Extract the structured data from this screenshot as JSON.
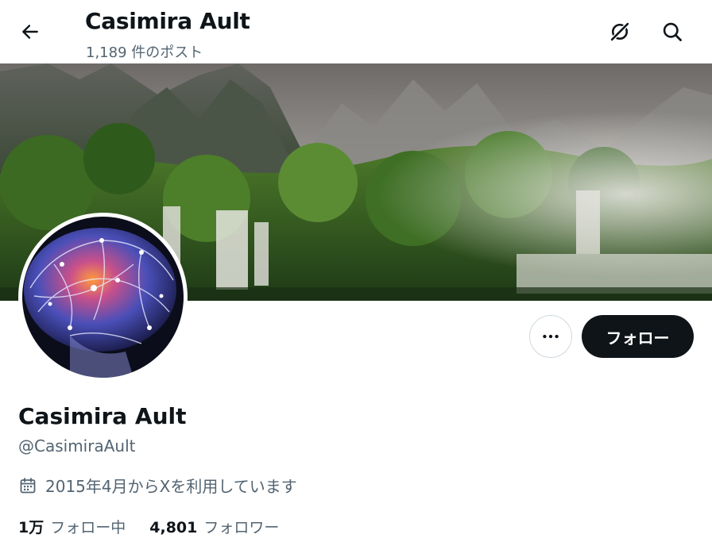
{
  "header": {
    "title": "Casimira Ault",
    "post_count": "1,189 件のポスト"
  },
  "icons": {
    "back": "arrow-left-icon",
    "grok": "grok-slash-icon",
    "search": "search-icon",
    "more": "more-horizontal-icon",
    "calendar": "calendar-icon"
  },
  "profile": {
    "display_name": "Casimira Ault",
    "handle": "@CasimiraAult",
    "joined": "2015年4月からXを利用しています",
    "follow_label": "フォロー"
  },
  "stats": {
    "following": {
      "count": "1万",
      "label": "フォロー中"
    },
    "followers": {
      "count": "4,801",
      "label": "フォロワー"
    }
  },
  "colors": {
    "text_primary": "#0f1419",
    "text_secondary": "#536471",
    "button_dark": "#0f1419",
    "border": "#cfd9de"
  }
}
